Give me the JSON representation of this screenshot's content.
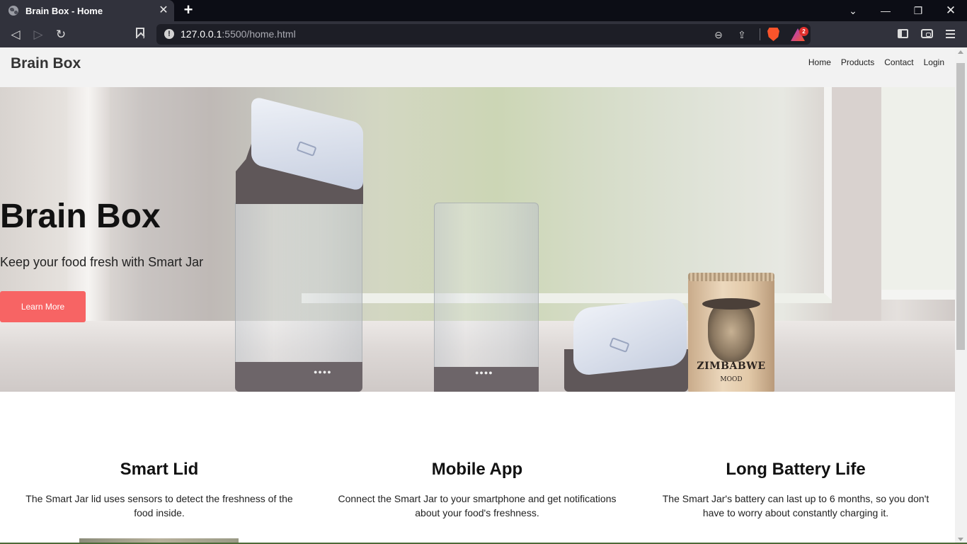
{
  "browser": {
    "tab": {
      "title": "Brain Box - Home",
      "favicon": "globe-icon"
    },
    "new_tab_icon": "plus-icon",
    "window_controls": [
      "chevron-down-icon",
      "minimize-icon",
      "restore-icon",
      "close-icon"
    ],
    "toolbar": {
      "back_icon": "back-icon",
      "forward_icon": "forward-icon",
      "reload_icon": "reload-icon",
      "bookmark_icon": "bookmark-icon"
    },
    "address_bar": {
      "security_icon": "info-icon",
      "url_host": "127.0.0.1",
      "url_rest": ":5500/home.html",
      "zoom_icon": "zoom-out-icon",
      "share_icon": "share-icon",
      "shields_icon": "brave-shields-icon",
      "rewards_icon": "brave-rewards-icon",
      "rewards_badge": "2"
    },
    "right_icons": [
      "sidebar-icon",
      "wallet-icon",
      "menu-icon"
    ]
  },
  "site": {
    "logo": "Brain Box",
    "nav": [
      "Home",
      "Products",
      "Contact",
      "Login"
    ]
  },
  "hero": {
    "title": "Brain Box",
    "subtitle": "Keep your food fresh with Smart Jar",
    "button": "Learn More",
    "button_color": "#f76464",
    "product_text": {
      "name": "ZIMBABWE",
      "sub": "MOOD"
    }
  },
  "features": [
    {
      "title": "Smart Lid",
      "text": "The Smart Jar lid uses sensors to detect the freshness of the food inside."
    },
    {
      "title": "Mobile App",
      "text": "Connect the Smart Jar to your smartphone and get notifications about your food's freshness."
    },
    {
      "title": "Long Battery Life",
      "text": "The Smart Jar's battery can last up to 6 months, so you don't have to worry about constantly charging it."
    }
  ]
}
